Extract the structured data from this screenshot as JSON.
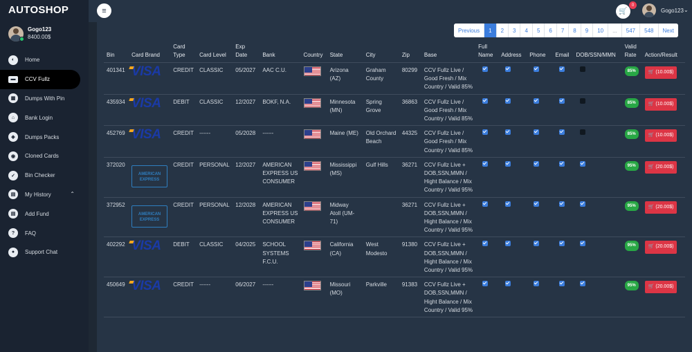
{
  "app": {
    "brand": "AUTOSHOP"
  },
  "user": {
    "name": "Gogo123",
    "balance": "8400.00$"
  },
  "nav": [
    {
      "label": "Home",
      "icon": "dashboard-icon",
      "glyph": "◐"
    },
    {
      "label": "CCV Fullz",
      "icon": "credit-card-icon",
      "glyph": "▬",
      "active": true
    },
    {
      "label": "Dumps With Pin",
      "icon": "table-icon",
      "glyph": "▦"
    },
    {
      "label": "Bank Login",
      "icon": "bank-icon",
      "glyph": "⌂"
    },
    {
      "label": "Dumps Packs",
      "icon": "box-icon",
      "glyph": "◈"
    },
    {
      "label": "Cloned Cards",
      "icon": "user-secret-icon",
      "glyph": "◉"
    },
    {
      "label": "Bin Checker",
      "icon": "check-icon",
      "glyph": "✓"
    },
    {
      "label": "My History",
      "icon": "document-icon",
      "glyph": "▤",
      "expandable": true
    },
    {
      "label": "Add Fund",
      "icon": "receipt-icon",
      "glyph": "▤"
    },
    {
      "label": "FAQ",
      "icon": "question-icon",
      "glyph": "?"
    },
    {
      "label": "Support Chat",
      "icon": "chat-icon",
      "glyph": "●"
    }
  ],
  "topbar": {
    "cart_count": "0",
    "username": "Gogo123"
  },
  "pagination": {
    "items": [
      "Previous",
      "1",
      "2",
      "3",
      "4",
      "5",
      "6",
      "7",
      "8",
      "9",
      "10",
      "...",
      "547",
      "548",
      "Next"
    ],
    "active": "1"
  },
  "table": {
    "headers": [
      "Bin",
      "Card Brand",
      "Card Type",
      "Card Level",
      "Exp Date",
      "Bank",
      "Country",
      "State",
      "City",
      "Zip",
      "Base",
      "Full Name",
      "Address",
      "Phone",
      "Email",
      "DOB/SSN/MMN",
      "Valid Rate",
      "Action/Result"
    ],
    "rows": [
      {
        "bin": "401341",
        "brand": "visa",
        "brand_text": "VISA",
        "type": "CREDIT",
        "level": "CLASSIC",
        "exp": "05/2027",
        "bank": "AAC C.U.",
        "state": "Arizona (AZ)",
        "city": "Graham County",
        "zip": "80299",
        "base": "CCV Fullz Live / Good Fresh / Mix Country / Valid 85%",
        "fullname": true,
        "address": true,
        "phone": true,
        "email": true,
        "dob": false,
        "rate": "85%",
        "price": "(10.00$)"
      },
      {
        "bin": "435934",
        "brand": "visa",
        "brand_text": "VISA",
        "type": "DEBIT",
        "level": "CLASSIC",
        "exp": "12/2027",
        "bank": "BOKF, N.A.",
        "state": "Minnesota (MN)",
        "city": "Spring Grove",
        "zip": "36863",
        "base": "CCV Fullz Live / Good Fresh / Mix Country / Valid 85%",
        "fullname": true,
        "address": true,
        "phone": true,
        "email": true,
        "dob": false,
        "rate": "85%",
        "price": "(10.00$)"
      },
      {
        "bin": "452769",
        "brand": "visa",
        "brand_text": "VISA",
        "type": "CREDIT",
        "level": "------",
        "exp": "05/2028",
        "bank": "------",
        "state": "Maine (ME)",
        "city": "Old Orchard Beach",
        "zip": "44325",
        "base": "CCV Fullz Live / Good Fresh / Mix Country / Valid 85%",
        "fullname": true,
        "address": true,
        "phone": true,
        "email": true,
        "dob": false,
        "rate": "85%",
        "price": "(10.00$)"
      },
      {
        "bin": "372020",
        "brand": "amex",
        "brand_text": "AMERICAN EXPRESS",
        "type": "CREDIT",
        "level": "PERSONAL",
        "exp": "12/2027",
        "bank": "AMERICAN EXPRESS US CONSUMER",
        "state": "Mississippi (MS)",
        "city": "Gulf Hills",
        "zip": "36271",
        "base": "CCV Fullz Live + DOB,SSN,MMN / Hight Balance / Mix Country / Valid 95%",
        "fullname": true,
        "address": true,
        "phone": true,
        "email": true,
        "dob": true,
        "rate": "95%",
        "price": "(20.00$)"
      },
      {
        "bin": "372952",
        "brand": "amex",
        "brand_text": "AMERICAN EXPRESS",
        "type": "CREDIT",
        "level": "PERSONAL",
        "exp": "12/2028",
        "bank": "AMERICAN EXPRESS US CONSUMER",
        "state": "Midway Atoll (UM-71)",
        "city": "",
        "zip": "36271",
        "base": "CCV Fullz Live + DOB,SSN,MMN / Hight Balance / Mix Country / Valid 95%",
        "fullname": true,
        "address": true,
        "phone": true,
        "email": true,
        "dob": true,
        "rate": "95%",
        "price": "(20.00$)"
      },
      {
        "bin": "402292",
        "brand": "visa",
        "brand_text": "VISA",
        "type": "DEBIT",
        "level": "CLASSIC",
        "exp": "04/2025",
        "bank": "SCHOOL SYSTEMS F.C.U.",
        "state": "California (CA)",
        "city": "West Modesto",
        "zip": "91380",
        "base": "CCV Fullz Live + DOB,SSN,MMN / Hight Balance / Mix Country / Valid 95%",
        "fullname": true,
        "address": true,
        "phone": true,
        "email": true,
        "dob": true,
        "rate": "95%",
        "price": "(20.00$)"
      },
      {
        "bin": "450649",
        "brand": "visa",
        "brand_text": "VISA",
        "type": "CREDIT",
        "level": "------",
        "exp": "06/2027",
        "bank": "------",
        "state": "Missouri (MO)",
        "city": "Parkville",
        "zip": "91383",
        "base": "CCV Fullz Live + DOB,SSN,MMN / Hight Balance / Mix Country / Valid 95%",
        "fullname": true,
        "address": true,
        "phone": true,
        "email": true,
        "dob": true,
        "rate": "95%",
        "price": "(20.00$)"
      }
    ]
  }
}
